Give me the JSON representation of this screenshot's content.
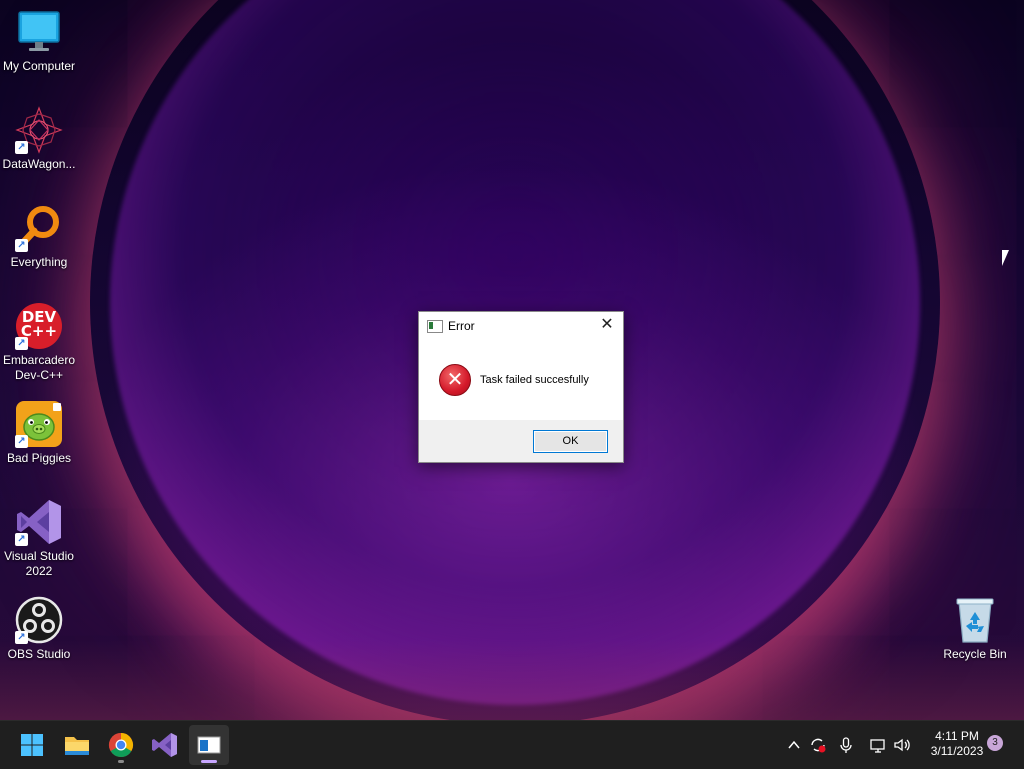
{
  "desktop": {
    "icons": [
      {
        "label": "My Computer",
        "icon": "monitor-icon"
      },
      {
        "label": "DataWagon...",
        "icon": "datawagon-icon"
      },
      {
        "label": "Everything",
        "icon": "everything-search-icon"
      },
      {
        "label": "Embarcadero Dev-C++",
        "icon": "devcpp-icon"
      },
      {
        "label": "Bad Piggies",
        "icon": "bad-piggies-icon"
      },
      {
        "label": "Visual Studio 2022",
        "icon": "visual-studio-icon"
      },
      {
        "label": "OBS Studio",
        "icon": "obs-icon"
      }
    ],
    "recycle_bin": {
      "label": "Recycle Bin",
      "icon": "recycle-bin-icon"
    },
    "devcpp_badge": "DEV C++"
  },
  "dialog": {
    "title": "Error",
    "message": "Task failed succesfully",
    "ok_label": "OK",
    "close_glyph": "✕",
    "error_glyph": "✕"
  },
  "taskbar": {
    "apps": [
      {
        "name": "start",
        "icon": "windows-start-icon"
      },
      {
        "name": "file-explorer",
        "icon": "folder-icon"
      },
      {
        "name": "chrome",
        "icon": "chrome-icon"
      },
      {
        "name": "visual-studio",
        "icon": "visual-studio-icon"
      },
      {
        "name": "error-app",
        "icon": "app-window-icon",
        "active": true
      }
    ],
    "tray": {
      "chevron": "^",
      "time": "4:11 PM",
      "date": "3/11/2023",
      "notification_count": "3"
    }
  },
  "colors": {
    "accent": "#0078d4",
    "error_red": "#d4192a",
    "taskbar_bg": "#1f1f1f"
  }
}
